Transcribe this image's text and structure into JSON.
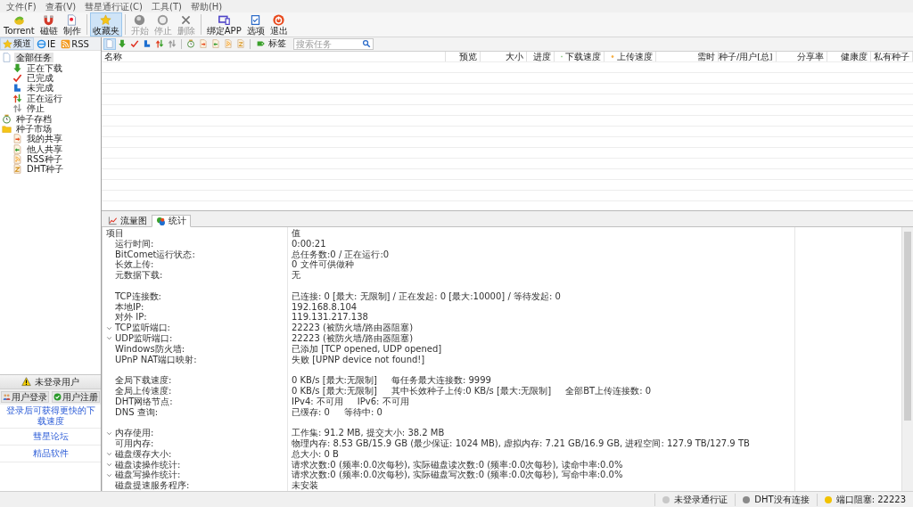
{
  "menu": [
    "文件(F)",
    "查看(V)",
    "彗星通行证(C)",
    "工具(T)",
    "帮助(H)"
  ],
  "toolbar": [
    [
      {
        "label": "Torrent",
        "kind": "torrent",
        "disabled": false,
        "pressed": false
      },
      {
        "label": "磁链",
        "kind": "magnet",
        "disabled": false,
        "pressed": false
      },
      {
        "label": "制作",
        "kind": "make",
        "disabled": false,
        "pressed": false
      }
    ],
    [
      {
        "label": "收藏夹",
        "kind": "favorites",
        "disabled": false,
        "pressed": true
      }
    ],
    [
      {
        "label": "开始",
        "kind": "start",
        "disabled": true,
        "pressed": false
      },
      {
        "label": "停止",
        "kind": "stop",
        "disabled": true,
        "pressed": false
      },
      {
        "label": "删除",
        "kind": "delete",
        "disabled": true,
        "pressed": false
      }
    ],
    [
      {
        "label": "绑定APP",
        "kind": "bindapp",
        "disabled": false,
        "pressed": false
      },
      {
        "label": "选项",
        "kind": "options",
        "disabled": false,
        "pressed": false
      },
      {
        "label": "退出",
        "kind": "exit",
        "disabled": false,
        "pressed": false
      }
    ]
  ],
  "sidebar": {
    "tabs": [
      {
        "label": "频道",
        "kind": "favorites",
        "selected": true
      },
      {
        "label": "IE",
        "kind": "ie",
        "selected": false
      },
      {
        "label": "RSS",
        "kind": "rss",
        "selected": false
      }
    ],
    "tree": [
      {
        "label": "全部任务",
        "kind": "all",
        "selected": true,
        "children": [
          {
            "label": "正在下载",
            "kind": "downloading",
            "selected": false
          },
          {
            "label": "已完成",
            "kind": "completed",
            "selected": false
          },
          {
            "label": "未完成",
            "kind": "incomplete",
            "selected": false
          },
          {
            "label": "正在运行",
            "kind": "running",
            "selected": false
          },
          {
            "label": "停止",
            "kind": "stopped",
            "selected": false
          }
        ]
      },
      {
        "label": "种子存档",
        "kind": "archive",
        "selected": false
      },
      {
        "label": "种子市场",
        "kind": "market",
        "selected": false,
        "children": [
          {
            "label": "我的共享",
            "kind": "share",
            "selected": false
          },
          {
            "label": "他人共享",
            "kind": "others",
            "selected": false
          },
          {
            "label": "RSS种子",
            "kind": "rssfile",
            "selected": false
          },
          {
            "label": "DHT种子",
            "kind": "dht",
            "selected": false
          }
        ]
      }
    ],
    "account": {
      "title": "未登录用户",
      "buttons": [
        {
          "label": "用户登录",
          "kind": "login"
        },
        {
          "label": "用户注册",
          "kind": "register"
        }
      ],
      "links": [
        "登录后可获得更快的下载速度",
        "彗星论坛",
        "精品软件"
      ]
    }
  },
  "task_toolbar": {
    "filters": [
      [
        {
          "kind": "all",
          "pressed": true
        },
        {
          "kind": "downloading",
          "pressed": false
        },
        {
          "kind": "completed",
          "pressed": false
        },
        {
          "kind": "incomplete",
          "pressed": false
        },
        {
          "kind": "running",
          "pressed": false
        },
        {
          "kind": "stopped",
          "pressed": false
        }
      ],
      [
        {
          "kind": "archive",
          "pressed": false
        },
        {
          "kind": "share",
          "pressed": false
        },
        {
          "kind": "others",
          "pressed": false
        },
        {
          "kind": "rssfile",
          "pressed": false
        },
        {
          "kind": "dht",
          "pressed": false
        }
      ]
    ],
    "tag_button": "标签",
    "search": {
      "placeholder": "搜索任务"
    }
  },
  "table": {
    "columns": [
      {
        "label": "名称",
        "kind": "text"
      },
      {
        "label": "预览",
        "kind": "text"
      },
      {
        "label": "大小",
        "kind": "text"
      },
      {
        "label": "进度",
        "kind": "text"
      },
      {
        "label": "下载速度",
        "kind": "download"
      },
      {
        "label": "上传速度",
        "kind": "upload"
      },
      {
        "label": "需时",
        "kind": "text"
      },
      {
        "label": "种子/用户[总]",
        "kind": "text"
      },
      {
        "label": "分享率",
        "kind": "text"
      },
      {
        "label": "健康度",
        "kind": "text"
      },
      {
        "label": "私有种子",
        "kind": "text"
      }
    ]
  },
  "bottom_tabs": [
    {
      "label": "流量图",
      "kind": "chart",
      "selected": false
    },
    {
      "label": "统计",
      "kind": "stats",
      "selected": true
    }
  ],
  "stats": {
    "columns": [
      "项目",
      "值"
    ],
    "rows": [
      {
        "kind": "plain",
        "label": "运行时间:",
        "parts": [
          "0:00:21"
        ]
      },
      {
        "kind": "plain",
        "label": "BitComet运行状态:",
        "parts": [
          "总任务数:0 / 正在运行:0"
        ]
      },
      {
        "kind": "plain",
        "label": "长效上传:",
        "parts": [
          "0 文件可供做种"
        ]
      },
      {
        "kind": "plain",
        "label": "元数据下载:",
        "parts": [
          "无"
        ]
      },
      {
        "kind": "blank"
      },
      {
        "kind": "plain",
        "label": "TCP连接数:",
        "parts": [
          "已连接: 0 [最大: 无限制] / 正在发起: 0 [最大:10000] / 等待发起: 0"
        ]
      },
      {
        "kind": "plain",
        "label": "本地IP:",
        "parts": [
          "192.168.8.104"
        ]
      },
      {
        "kind": "plain",
        "label": "对外 IP:",
        "parts": [
          "119.131.217.138"
        ]
      },
      {
        "kind": "toggle",
        "expanded": true,
        "label": "TCP监听端口:",
        "parts": [
          "22223 (被防火墙/路由器阻塞)"
        ]
      },
      {
        "kind": "toggle",
        "expanded": true,
        "label": "UDP监听端口:",
        "parts": [
          "22223 (被防火墙/路由器阻塞)"
        ]
      },
      {
        "kind": "plain",
        "label": "Windows防火墙:",
        "parts": [
          "已添加 [TCP opened, UDP opened]"
        ]
      },
      {
        "kind": "plain",
        "label": "UPnP NAT端口映射:",
        "parts": [
          "失败 [UPNP device not found!]"
        ]
      },
      {
        "kind": "blank"
      },
      {
        "kind": "plain",
        "label": "全局下载速度:",
        "parts": [
          "0 KB/s [最大:无限制]",
          "每任务最大连接数: 9999"
        ]
      },
      {
        "kind": "plain",
        "label": "全局上传速度:",
        "parts": [
          "0 KB/s [最大:无限制]",
          "其中长效种子上传:0 KB/s [最大:无限制]",
          "全部BT上传连接数: 0"
        ]
      },
      {
        "kind": "plain",
        "label": "DHT网络节点:",
        "parts": [
          "IPv4: 不可用",
          "IPv6: 不可用"
        ]
      },
      {
        "kind": "plain",
        "label": "DNS 查询:",
        "parts": [
          "已缓存:  0",
          "等待中:  0"
        ]
      },
      {
        "kind": "blank"
      },
      {
        "kind": "toggle",
        "expanded": true,
        "label": "内存使用:",
        "parts": [
          "工作集: 91.2 MB, 提交大小: 38.2 MB"
        ]
      },
      {
        "kind": "plain",
        "label": "可用内存:",
        "parts": [
          "物理内存: 8.53 GB/15.9 GB (最少保证: 1024 MB), 虚拟内存: 7.21 GB/16.9 GB, 进程空间: 127.9 TB/127.9 TB"
        ]
      },
      {
        "kind": "toggle",
        "expanded": true,
        "label": "磁盘缓存大小:",
        "parts": [
          "总大小:  0 B"
        ]
      },
      {
        "kind": "toggle",
        "expanded": true,
        "label": "磁盘读操作统计:",
        "parts": [
          "请求次数:0 (频率:0.0次每秒), 实际磁盘读次数:0 (频率:0.0次每秒), 读命中率:0.0%"
        ]
      },
      {
        "kind": "toggle",
        "expanded": true,
        "label": "磁盘写操作统计:",
        "parts": [
          "请求次数:0 (频率:0.0次每秒), 实际磁盘写次数:0 (频率:0.0次每秒), 写命中率:0.0%"
        ]
      },
      {
        "kind": "plain",
        "label": "磁盘提速服务程序:",
        "parts": [
          "未安装"
        ]
      }
    ]
  },
  "status_bar": [
    {
      "label": "未登录通行证",
      "color": "#c8c8c8"
    },
    {
      "label": "DHT没有连接",
      "color": "#8a8a8a"
    },
    {
      "label": "端口阻塞: 22223",
      "color": "#f2c200"
    }
  ]
}
